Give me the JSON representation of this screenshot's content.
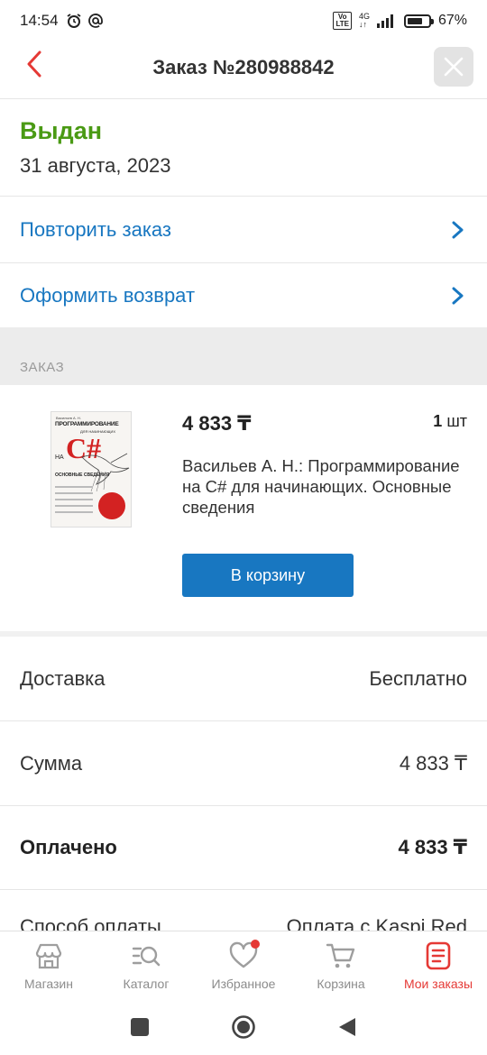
{
  "status_bar": {
    "time": "14:54",
    "battery": "67%",
    "network": "4G"
  },
  "header": {
    "title": "Заказ №280988842"
  },
  "order_status": {
    "label": "Выдан",
    "date": "31 августа, 2023"
  },
  "actions": [
    {
      "label": "Повторить заказ"
    },
    {
      "label": "Оформить возврат"
    }
  ],
  "section": {
    "title": "ЗАКАЗ"
  },
  "product": {
    "price": "4 833 ₸",
    "quantity_value": "1",
    "quantity_unit": "шт",
    "name": "Васильев А. Н.: Программирование на C# для начинающих. Основные сведения",
    "cart_button": "В корзину",
    "cover": {
      "author": "Васильев А. Н.",
      "title": "ПРОГРАММИРОВАНИЕ",
      "subtitle": "ДЛЯ НАЧИНАЮЩИХ",
      "na": "НА",
      "lang": "C#",
      "section": "ОСНОВНЫЕ СВЕДЕНИЯ"
    }
  },
  "summary": [
    {
      "key": "Доставка",
      "value": "Бесплатно",
      "bold": false
    },
    {
      "key": "Сумма",
      "value": "4 833 ₸",
      "bold": false
    },
    {
      "key": "Оплачено",
      "value": "4 833 ₸",
      "bold": true
    },
    {
      "key": "Способ оплаты",
      "value": "Оплата с Kaspi Red",
      "bold": false
    }
  ],
  "bottom_nav": [
    {
      "label": "Магазин",
      "icon": "store-icon"
    },
    {
      "label": "Каталог",
      "icon": "catalog-search-icon"
    },
    {
      "label": "Избранное",
      "icon": "heart-icon"
    },
    {
      "label": "Корзина",
      "icon": "cart-icon"
    },
    {
      "label": "Мои заказы",
      "icon": "orders-icon",
      "active": true
    }
  ],
  "colors": {
    "accent_blue": "#1877c1",
    "status_green": "#4a9a14",
    "active_red": "#e53935"
  }
}
